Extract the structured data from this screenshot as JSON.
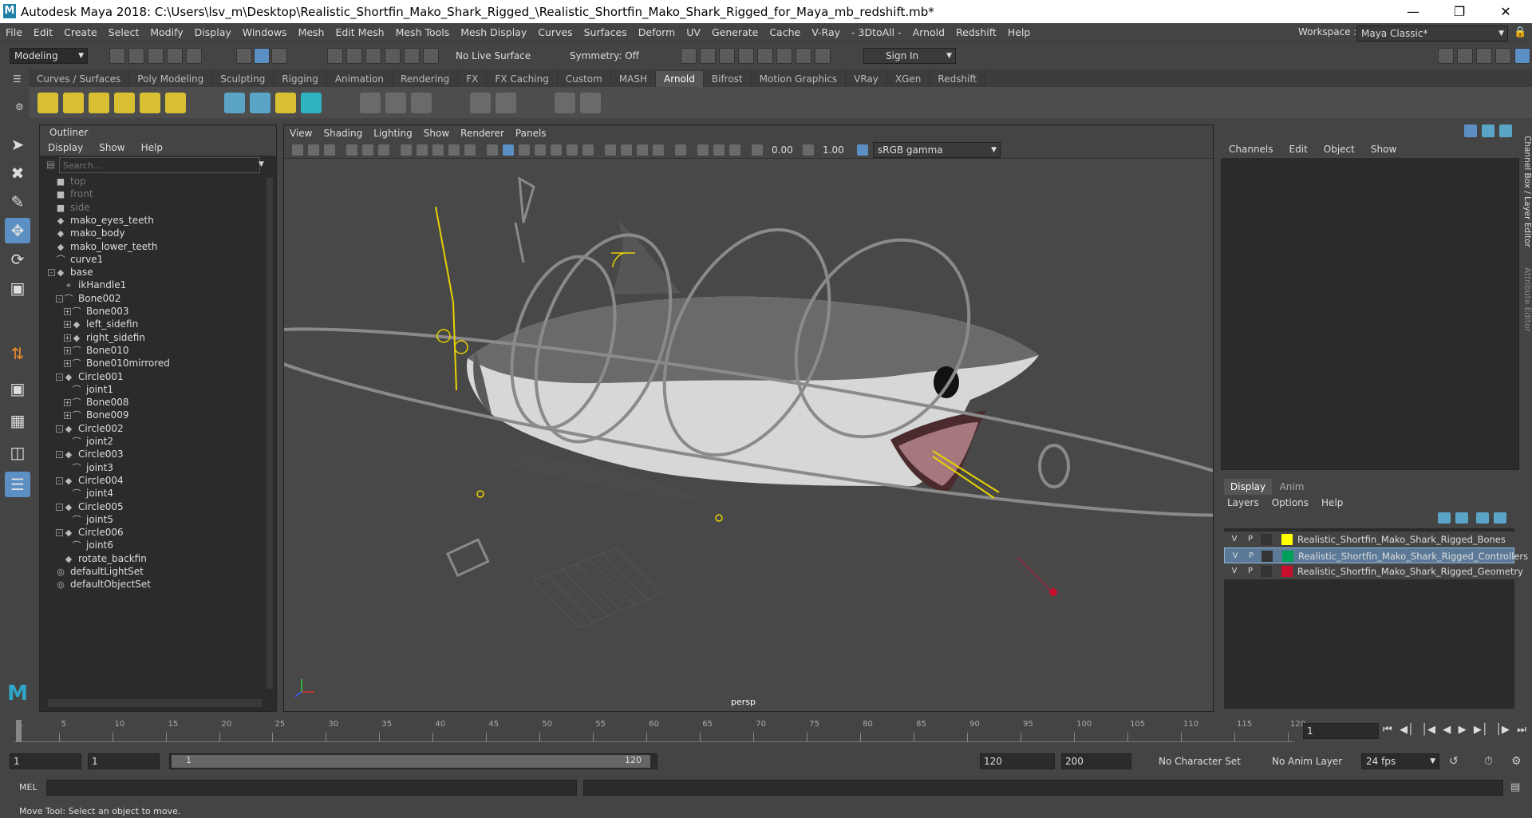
{
  "window": {
    "title": "Autodesk Maya 2018: C:\\Users\\lsv_m\\Desktop\\Realistic_Shortfin_Mako_Shark_Rigged_\\Realistic_Shortfin_Mako_Shark_Rigged_for_Maya_mb_redshift.mb*"
  },
  "menubar": [
    "File",
    "Edit",
    "Create",
    "Select",
    "Modify",
    "Display",
    "Windows",
    "Mesh",
    "Edit Mesh",
    "Mesh Tools",
    "Mesh Display",
    "Curves",
    "Surfaces",
    "Deform",
    "UV",
    "Generate",
    "Cache",
    "V-Ray",
    "- 3DtoAll -",
    "Arnold",
    "Redshift",
    "Help"
  ],
  "workspace": {
    "label": "Workspace :",
    "value": "Maya Classic*"
  },
  "statusline": {
    "mode": "Modeling",
    "live_surface": "No Live Surface",
    "symmetry": "Symmetry: Off",
    "sign_in": "Sign In"
  },
  "shelf_tabs": [
    "Curves / Surfaces",
    "Poly Modeling",
    "Sculpting",
    "Rigging",
    "Animation",
    "Rendering",
    "FX",
    "FX Caching",
    "Custom",
    "MASH",
    "Arnold",
    "Bifrost",
    "Motion Graphics",
    "VRay",
    "XGen",
    "Redshift"
  ],
  "active_shelf": "Arnold",
  "outliner": {
    "title": "Outliner",
    "menu": [
      "Display",
      "Show",
      "Help"
    ],
    "search_placeholder": "Search...",
    "items": [
      {
        "label": "top",
        "icon": "camera-icon",
        "indent": 0,
        "dim": true,
        "expand": ""
      },
      {
        "label": "front",
        "icon": "camera-icon",
        "indent": 0,
        "dim": true,
        "expand": ""
      },
      {
        "label": "side",
        "icon": "camera-icon",
        "indent": 0,
        "dim": true,
        "expand": ""
      },
      {
        "label": "mako_eyes_teeth",
        "icon": "mesh-icon",
        "indent": 0,
        "dim": false,
        "expand": ""
      },
      {
        "label": "mako_body",
        "icon": "mesh-icon",
        "indent": 0,
        "dim": false,
        "expand": ""
      },
      {
        "label": "mako_lower_teeth",
        "icon": "mesh-icon",
        "indent": 0,
        "dim": false,
        "expand": ""
      },
      {
        "label": "curve1",
        "icon": "curve-icon",
        "indent": 0,
        "dim": false,
        "expand": ""
      },
      {
        "label": "base",
        "icon": "mesh-icon",
        "indent": 0,
        "dim": false,
        "expand": "-"
      },
      {
        "label": "ikHandle1",
        "icon": "ik-handle-icon",
        "indent": 1,
        "dim": false,
        "expand": ""
      },
      {
        "label": "Bone002",
        "icon": "curve-icon",
        "indent": 1,
        "dim": false,
        "expand": "-"
      },
      {
        "label": "Bone003",
        "icon": "curve-icon",
        "indent": 2,
        "dim": false,
        "expand": "+"
      },
      {
        "label": "left_sidefin",
        "icon": "mesh-icon",
        "indent": 2,
        "dim": false,
        "expand": "+"
      },
      {
        "label": "right_sidefin",
        "icon": "mesh-icon",
        "indent": 2,
        "dim": false,
        "expand": "+"
      },
      {
        "label": "Bone010",
        "icon": "curve-icon",
        "indent": 2,
        "dim": false,
        "expand": "+"
      },
      {
        "label": "Bone010mirrored",
        "icon": "curve-icon",
        "indent": 2,
        "dim": false,
        "expand": "+"
      },
      {
        "label": "Circle001",
        "icon": "mesh-icon",
        "indent": 1,
        "dim": false,
        "expand": "-"
      },
      {
        "label": "joint1",
        "icon": "joint-icon",
        "indent": 2,
        "dim": false,
        "expand": ""
      },
      {
        "label": "Bone008",
        "icon": "curve-icon",
        "indent": 2,
        "dim": false,
        "expand": "+"
      },
      {
        "label": "Bone009",
        "icon": "curve-icon",
        "indent": 2,
        "dim": false,
        "expand": "+"
      },
      {
        "label": "Circle002",
        "icon": "mesh-icon",
        "indent": 1,
        "dim": false,
        "expand": "-"
      },
      {
        "label": "joint2",
        "icon": "joint-icon",
        "indent": 2,
        "dim": false,
        "expand": ""
      },
      {
        "label": "Circle003",
        "icon": "mesh-icon",
        "indent": 1,
        "dim": false,
        "expand": "-"
      },
      {
        "label": "joint3",
        "icon": "joint-icon",
        "indent": 2,
        "dim": false,
        "expand": ""
      },
      {
        "label": "Circle004",
        "icon": "mesh-icon",
        "indent": 1,
        "dim": false,
        "expand": "-"
      },
      {
        "label": "joint4",
        "icon": "joint-icon",
        "indent": 2,
        "dim": false,
        "expand": ""
      },
      {
        "label": "Circle005",
        "icon": "mesh-icon",
        "indent": 1,
        "dim": false,
        "expand": "-"
      },
      {
        "label": "joint5",
        "icon": "joint-icon",
        "indent": 2,
        "dim": false,
        "expand": ""
      },
      {
        "label": "Circle006",
        "icon": "mesh-icon",
        "indent": 1,
        "dim": false,
        "expand": "-"
      },
      {
        "label": "joint6",
        "icon": "joint-icon",
        "indent": 2,
        "dim": false,
        "expand": ""
      },
      {
        "label": "rotate_backfin",
        "icon": "mesh-icon",
        "indent": 1,
        "dim": false,
        "expand": ""
      },
      {
        "label": "defaultLightSet",
        "icon": "set-icon",
        "indent": 0,
        "dim": false,
        "expand": ""
      },
      {
        "label": "defaultObjectSet",
        "icon": "set-icon",
        "indent": 0,
        "dim": false,
        "expand": ""
      }
    ]
  },
  "viewport": {
    "menu": [
      "View",
      "Shading",
      "Lighting",
      "Show",
      "Renderer",
      "Panels"
    ],
    "exposure": "0.00",
    "gamma": "1.00",
    "color_space": "sRGB gamma",
    "camera_label": "persp"
  },
  "channelbox": {
    "menu": [
      "Channels",
      "Edit",
      "Object",
      "Show"
    ],
    "side_tab": "Channel Box / Layer Editor",
    "side_tab2": "Attribute Editor"
  },
  "layer_editor": {
    "tabs": [
      "Display",
      "Anim"
    ],
    "menu": [
      "Layers",
      "Options",
      "Help"
    ],
    "layers": [
      {
        "v": "V",
        "p": "P",
        "color": "#ffff00",
        "name": "Realistic_Shortfin_Mako_Shark_Rigged_Bones",
        "selected": false
      },
      {
        "v": "V",
        "p": "P",
        "color": "#00a05a",
        "name": "Realistic_Shortfin_Mako_Shark_Rigged_Controllers",
        "selected": true
      },
      {
        "v": "V",
        "p": "P",
        "color": "#c8102e",
        "name": "Realistic_Shortfin_Mako_Shark_Rigged_Geometry",
        "selected": false
      }
    ]
  },
  "timeline": {
    "ticks": [
      "1",
      "5",
      "10",
      "15",
      "20",
      "25",
      "30",
      "35",
      "40",
      "45",
      "50",
      "55",
      "60",
      "65",
      "70",
      "75",
      "80",
      "85",
      "90",
      "95",
      "100",
      "105",
      "110",
      "115",
      "120"
    ],
    "current_frame": "1",
    "range_start": "1",
    "playback_start": "1",
    "range_slider_start": "1",
    "range_slider_end": "120",
    "playback_end": "120",
    "range_end": "200",
    "character_set": "No Character Set",
    "anim_layer": "No Anim Layer",
    "fps": "24 fps"
  },
  "command_line": {
    "label": "MEL"
  },
  "help_line": "Move Tool: Select an object to move."
}
